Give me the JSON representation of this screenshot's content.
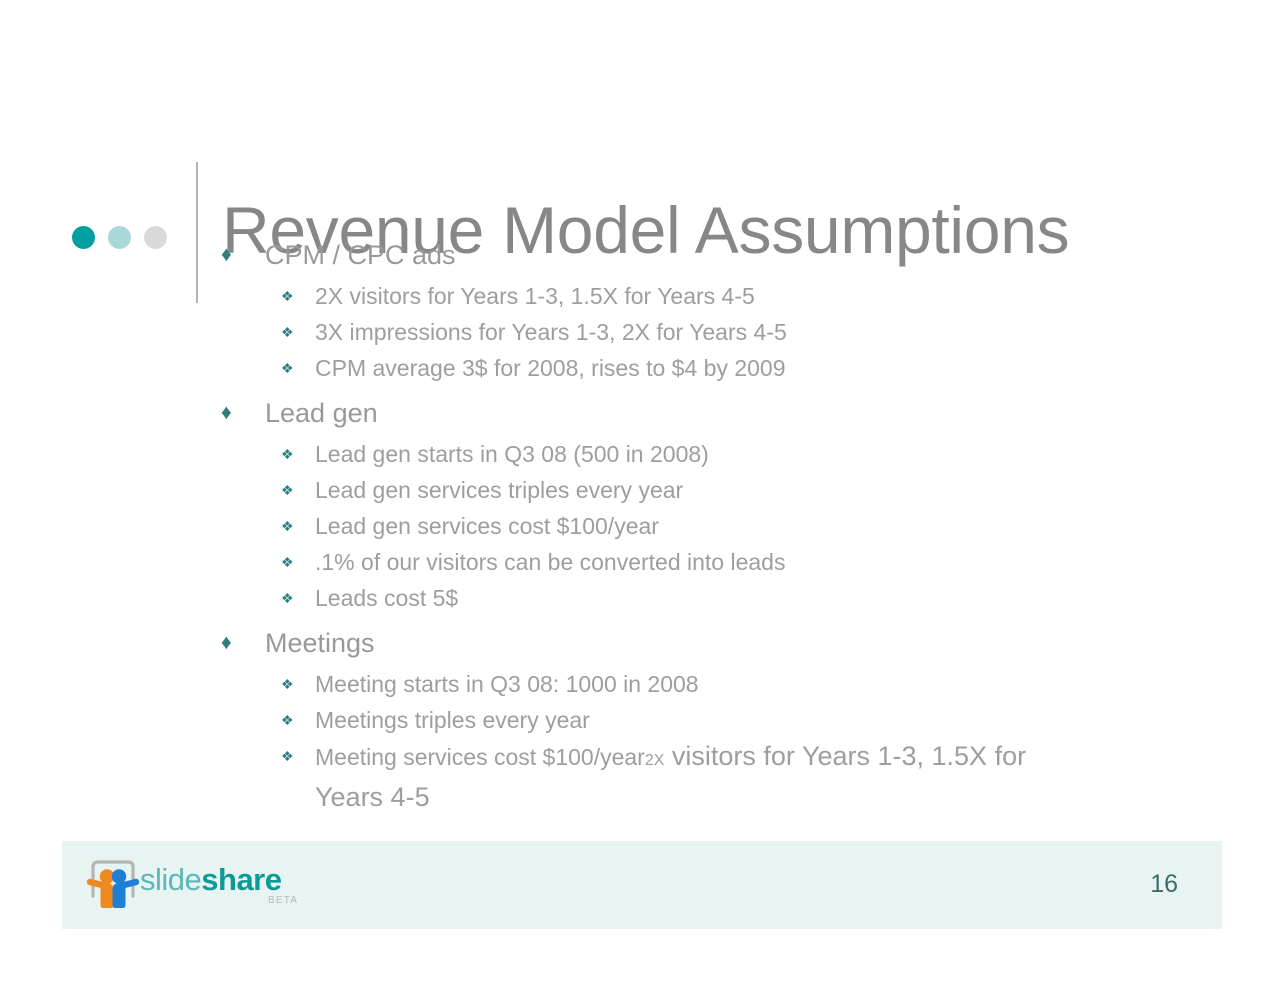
{
  "slide": {
    "background_color": "#ffffff",
    "title": "Revenue Model Assumptions",
    "title_color": "#878787",
    "page_number": "16"
  },
  "header": {
    "dots": [
      {
        "name": "dot-teal",
        "color": "#00a0a0"
      },
      {
        "name": "dot-light-teal",
        "color": "#a8d8d8"
      },
      {
        "name": "dot-gray",
        "color": "#d9d9d9"
      }
    ],
    "divider_color": "#b3b3b3"
  },
  "bullets": {
    "marker_level1": "♦",
    "marker_level2": "❖",
    "marker_color_level1": "#327d7d",
    "marker_color_level2": "#2e7d7d",
    "text_color": "#9e9e9e",
    "groups": [
      {
        "heading": "CPM / CPC ads",
        "items": [
          "2X visitors for Years 1-3, 1.5X for Years 4-5",
          "3X impressions for Years 1-3, 2X for Years 4-5",
          "CPM average 3$ for 2008, rises to $4 by 2009"
        ]
      },
      {
        "heading": "Lead gen",
        "items": [
          "Lead gen starts in Q3 08 (500 in 2008)",
          "Lead gen services triples every year",
          "Lead gen services cost $100/year",
          ".1% of our visitors can be converted into leads",
          "Leads cost 5$"
        ]
      },
      {
        "heading": "Meetings",
        "items": [
          "Meeting starts in Q3 08: 1000 in 2008",
          "Meetings triples every year"
        ],
        "last_item": {
          "lead": "Meeting services cost $100/year",
          "small": "2X",
          "trail": " visitors for Years 1-3, 1.5X for Years 4-5"
        }
      }
    ]
  },
  "footer": {
    "band_color": "#e8f4f2",
    "logo": {
      "word_light": "slide",
      "word_bold": "share",
      "beta": "BETA",
      "light_color": "#5cb8b8",
      "bold_color": "#0b9a95",
      "frame_color": "#b5b5b5",
      "figure_orange": "#f08a1e",
      "figure_blue": "#1f7fd4"
    }
  }
}
